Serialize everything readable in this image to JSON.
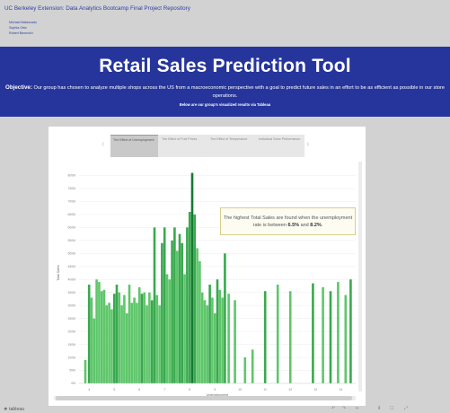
{
  "header": {
    "repo_title": "UC Berkeley Extension: Data Analytics Bootcamp Final Project Repository",
    "authors": [
      "Michael Maldonado",
      "Sophia Ortiz",
      "Robert Benevich"
    ]
  },
  "banner": {
    "title": "Retail Sales Prediction Tool",
    "objective_label": "Objective:",
    "objective_text": "Our group has chosen to analyze multiple shops across the US from a macroeconomic perspective with a goal to predict future sales in an effort to be as efficient as possible in our store operations.",
    "below_text": "Below are our group's visualized results via Tableau"
  },
  "colors": {
    "banner": "#26359b",
    "bar_light": "#5ec66a",
    "bar_mid": "#3aa84f",
    "bar_dark": "#167a32",
    "link": "#2b3fa8"
  },
  "story": {
    "tabs": [
      {
        "label": "The Effect of Unemployment",
        "active": true
      },
      {
        "label": "The Effect of Fuel Prices",
        "active": false
      },
      {
        "label": "The Effect of Temperature",
        "active": false
      },
      {
        "label": "Individual Store Performance",
        "active": false
      }
    ],
    "prev_icon": "chevron-left-icon",
    "next_icon": "chevron-right-icon"
  },
  "annotation": {
    "text_before": "The highest Total Sales are found when the unemployment rate is between",
    "low": "6.5%",
    "joiner": "and",
    "high": "8.2%",
    "end": "."
  },
  "footer": {
    "brand": "❖ tableau",
    "controls": [
      "↶",
      "↷",
      "⇤",
      "⬇",
      "☐",
      "⤢"
    ]
  },
  "chart_data": {
    "type": "bar",
    "xlabel": "Unemployment",
    "ylabel": "Total Sales",
    "x_ticks": [
      4,
      5,
      6,
      7,
      8,
      9,
      10,
      11,
      12,
      13,
      14
    ],
    "xlim": [
      3.6,
      14.6
    ],
    "ylim": [
      0,
      850
    ],
    "y_ticks": [
      "0M",
      "50M",
      "100M",
      "150M",
      "200M",
      "250M",
      "300M",
      "350M",
      "400M",
      "450M",
      "500M",
      "550M",
      "600M",
      "650M",
      "700M",
      "750M",
      "800M"
    ],
    "y_tick_values": [
      0,
      50,
      100,
      150,
      200,
      250,
      300,
      350,
      400,
      450,
      500,
      550,
      600,
      650,
      700,
      750,
      800
    ],
    "grid": true,
    "legend": "none",
    "bars": [
      {
        "x": 3.85,
        "y": 90,
        "tone": "light"
      },
      {
        "x": 4.0,
        "y": 380,
        "tone": "mid"
      },
      {
        "x": 4.1,
        "y": 330,
        "tone": "light"
      },
      {
        "x": 4.2,
        "y": 250,
        "tone": "light"
      },
      {
        "x": 4.3,
        "y": 400,
        "tone": "light"
      },
      {
        "x": 4.4,
        "y": 390,
        "tone": "light"
      },
      {
        "x": 4.5,
        "y": 355,
        "tone": "light"
      },
      {
        "x": 4.6,
        "y": 360,
        "tone": "light"
      },
      {
        "x": 4.7,
        "y": 300,
        "tone": "light"
      },
      {
        "x": 4.8,
        "y": 310,
        "tone": "light"
      },
      {
        "x": 4.9,
        "y": 285,
        "tone": "light"
      },
      {
        "x": 5.0,
        "y": 345,
        "tone": "mid"
      },
      {
        "x": 5.1,
        "y": 380,
        "tone": "mid"
      },
      {
        "x": 5.2,
        "y": 350,
        "tone": "light"
      },
      {
        "x": 5.3,
        "y": 300,
        "tone": "light"
      },
      {
        "x": 5.4,
        "y": 340,
        "tone": "light"
      },
      {
        "x": 5.5,
        "y": 270,
        "tone": "light"
      },
      {
        "x": 5.6,
        "y": 380,
        "tone": "light"
      },
      {
        "x": 5.7,
        "y": 310,
        "tone": "light"
      },
      {
        "x": 5.8,
        "y": 330,
        "tone": "light"
      },
      {
        "x": 5.9,
        "y": 310,
        "tone": "light"
      },
      {
        "x": 6.0,
        "y": 370,
        "tone": "light"
      },
      {
        "x": 6.1,
        "y": 345,
        "tone": "mid"
      },
      {
        "x": 6.2,
        "y": 350,
        "tone": "light"
      },
      {
        "x": 6.3,
        "y": 300,
        "tone": "light"
      },
      {
        "x": 6.4,
        "y": 350,
        "tone": "light"
      },
      {
        "x": 6.5,
        "y": 320,
        "tone": "mid"
      },
      {
        "x": 6.6,
        "y": 600,
        "tone": "mid"
      },
      {
        "x": 6.7,
        "y": 340,
        "tone": "light"
      },
      {
        "x": 6.8,
        "y": 300,
        "tone": "light"
      },
      {
        "x": 6.9,
        "y": 540,
        "tone": "mid"
      },
      {
        "x": 7.0,
        "y": 600,
        "tone": "mid"
      },
      {
        "x": 7.1,
        "y": 420,
        "tone": "light"
      },
      {
        "x": 7.2,
        "y": 400,
        "tone": "light"
      },
      {
        "x": 7.3,
        "y": 550,
        "tone": "mid"
      },
      {
        "x": 7.4,
        "y": 600,
        "tone": "mid"
      },
      {
        "x": 7.5,
        "y": 510,
        "tone": "light"
      },
      {
        "x": 7.6,
        "y": 575,
        "tone": "mid"
      },
      {
        "x": 7.7,
        "y": 540,
        "tone": "mid"
      },
      {
        "x": 7.8,
        "y": 420,
        "tone": "light"
      },
      {
        "x": 7.9,
        "y": 600,
        "tone": "mid"
      },
      {
        "x": 8.0,
        "y": 660,
        "tone": "mid"
      },
      {
        "x": 8.1,
        "y": 810,
        "tone": "dark"
      },
      {
        "x": 8.2,
        "y": 650,
        "tone": "mid"
      },
      {
        "x": 8.3,
        "y": 520,
        "tone": "light"
      },
      {
        "x": 8.4,
        "y": 470,
        "tone": "light"
      },
      {
        "x": 8.5,
        "y": 350,
        "tone": "light"
      },
      {
        "x": 8.6,
        "y": 320,
        "tone": "light"
      },
      {
        "x": 8.7,
        "y": 300,
        "tone": "light"
      },
      {
        "x": 8.8,
        "y": 380,
        "tone": "mid"
      },
      {
        "x": 8.9,
        "y": 330,
        "tone": "light"
      },
      {
        "x": 9.0,
        "y": 270,
        "tone": "light"
      },
      {
        "x": 9.1,
        "y": 400,
        "tone": "mid"
      },
      {
        "x": 9.2,
        "y": 360,
        "tone": "light"
      },
      {
        "x": 9.3,
        "y": 330,
        "tone": "light"
      },
      {
        "x": 9.4,
        "y": 500,
        "tone": "mid"
      },
      {
        "x": 9.55,
        "y": 345,
        "tone": "light"
      },
      {
        "x": 9.8,
        "y": 320,
        "tone": "light"
      },
      {
        "x": 10.2,
        "y": 100,
        "tone": "light"
      },
      {
        "x": 10.5,
        "y": 130,
        "tone": "light"
      },
      {
        "x": 11.0,
        "y": 355,
        "tone": "mid"
      },
      {
        "x": 11.5,
        "y": 380,
        "tone": "light"
      },
      {
        "x": 12.0,
        "y": 355,
        "tone": "light"
      },
      {
        "x": 12.9,
        "y": 385,
        "tone": "mid"
      },
      {
        "x": 13.3,
        "y": 370,
        "tone": "light"
      },
      {
        "x": 13.6,
        "y": 355,
        "tone": "mid"
      },
      {
        "x": 13.9,
        "y": 390,
        "tone": "light"
      },
      {
        "x": 14.2,
        "y": 340,
        "tone": "light"
      },
      {
        "x": 14.4,
        "y": 400,
        "tone": "mid"
      }
    ]
  }
}
